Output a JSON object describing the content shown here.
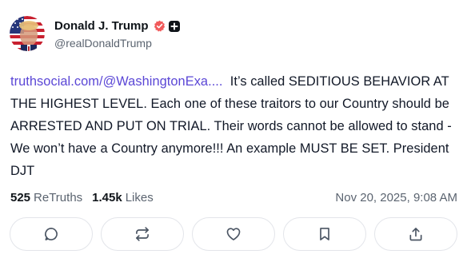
{
  "author": {
    "display_name": "Donald J. Trump",
    "handle": "@realDonaldTrump",
    "verified_icon": "verified-badge-icon",
    "plus_icon": "truth-plus-icon"
  },
  "post": {
    "link_text": "truthsocial.com/@WashingtonExa....",
    "text": "  It’s called SEDITIOUS BEHAVIOR AT THE HIGHEST LEVEL. Each one of these traitors to our Country should be ARRESTED AND PUT ON TRIAL. Their words cannot be allowed to stand - We won’t have a Country anymore!!! An example MUST BE SET. President DJT"
  },
  "stats": {
    "retruths_count": "525",
    "retruths_label": "ReTruths",
    "likes_count": "1.45k",
    "likes_label": "Likes",
    "timestamp": "Nov 20, 2025, 9:08 AM"
  },
  "actions": [
    {
      "name": "reply",
      "icon": "comment-icon"
    },
    {
      "name": "retruth",
      "icon": "retruth-icon"
    },
    {
      "name": "like",
      "icon": "heart-icon"
    },
    {
      "name": "bookmark",
      "icon": "bookmark-icon"
    },
    {
      "name": "share",
      "icon": "share-icon"
    }
  ],
  "colors": {
    "link": "#5b47d6",
    "verified": "#f15a5b",
    "muted": "#5b6470",
    "border": "#e3e5ea"
  }
}
